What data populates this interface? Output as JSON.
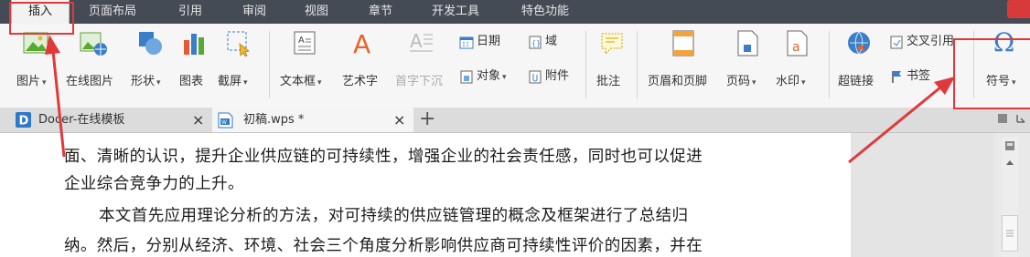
{
  "menubar": {
    "items": [
      {
        "label": "插入",
        "active": true
      },
      {
        "label": "页面布局"
      },
      {
        "label": "引用"
      },
      {
        "label": "审阅"
      },
      {
        "label": "视图"
      },
      {
        "label": "章节"
      },
      {
        "label": "开发工具"
      },
      {
        "label": "特色功能"
      }
    ]
  },
  "ribbon": {
    "picture": "图片",
    "online_picture": "在线图片",
    "shape": "形状",
    "chart": "图表",
    "screenshot": "截屏",
    "textbox": "文本框",
    "wordart": "艺术字",
    "dropcap": "首字下沉",
    "date": "日期",
    "field": "域",
    "object": "对象",
    "attachment": "附件",
    "comment": "批注",
    "header_footer": "页眉和页脚",
    "page_number": "页码",
    "watermark": "水印",
    "hyperlink": "超链接",
    "cross_reference": "交叉引用",
    "bookmark": "书签",
    "symbol": "符号",
    "symbol_glyph": "Ω"
  },
  "tabs": [
    {
      "label": "Docer-在线模板",
      "icon": "docer-logo-icon",
      "active": false
    },
    {
      "label": "初稿.wps *",
      "icon": "wps-doc-icon",
      "active": true
    }
  ],
  "new_tab_glyph": "+",
  "document": {
    "lines": [
      "面、清晰的认识，提升企业供应链的可持续性，增强企业的社会责任感，同时也可以促进",
      "企业综合竞争力的上升。",
      "本文首先应用理论分析的方法，对可持续的供应链管理的概念及框架进行了总结归",
      "纳。然后，分别从经济、环境、社会三个角度分析影响供应商可持续性评价的因素，并在"
    ]
  },
  "colors": {
    "menubar_bg": "#454b55",
    "annotation_red": "#e0393c",
    "ribbon_bg": "#f6f6f6"
  }
}
